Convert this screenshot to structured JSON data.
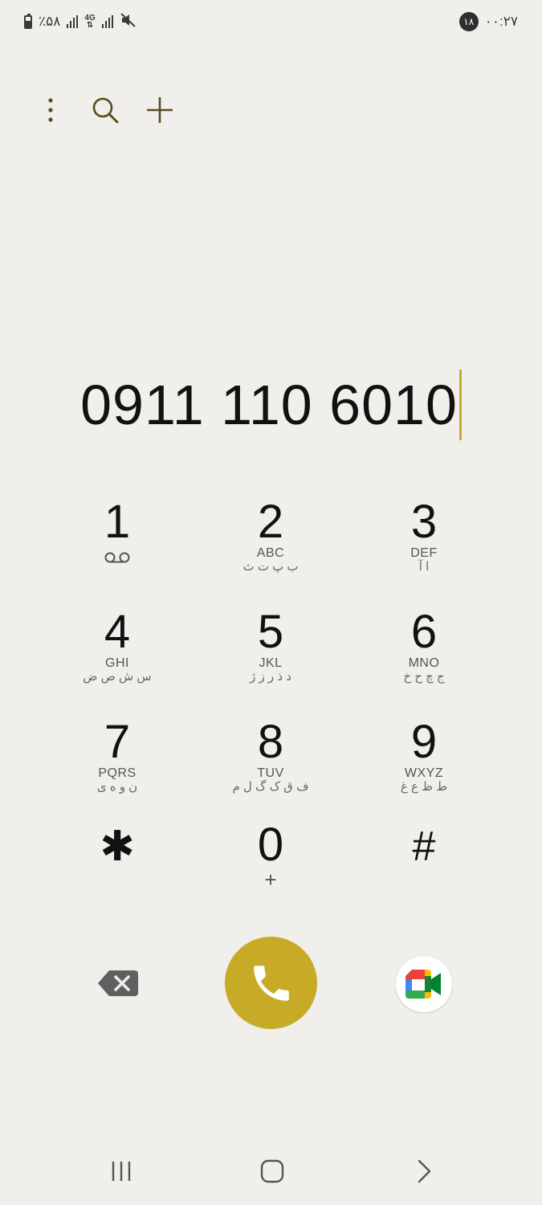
{
  "status_bar": {
    "battery_text": "٪۵۸",
    "network_type": "4G",
    "notification_count": "۱۸",
    "time": "۰۰:۲۷"
  },
  "toolbar": {
    "more_icon": "more-vert-icon",
    "search_icon": "search-icon",
    "add_icon": "add-icon"
  },
  "dialer": {
    "number": "0911 110 6010",
    "accent_color": "#c7ab27",
    "keys": [
      {
        "digit": "1",
        "letters": "",
        "farsi": "",
        "sub": "voicemail-icon"
      },
      {
        "digit": "2",
        "letters": "ABC",
        "farsi": "ب پ ت ث",
        "sub": ""
      },
      {
        "digit": "3",
        "letters": "DEF",
        "farsi": "ا آ",
        "sub": ""
      },
      {
        "digit": "4",
        "letters": "GHI",
        "farsi": "س ش ص ض",
        "sub": ""
      },
      {
        "digit": "5",
        "letters": "JKL",
        "farsi": "د ذ ر ز ژ",
        "sub": ""
      },
      {
        "digit": "6",
        "letters": "MNO",
        "farsi": "ج چ ح خ",
        "sub": ""
      },
      {
        "digit": "7",
        "letters": "PQRS",
        "farsi": "ن و ه ی",
        "sub": ""
      },
      {
        "digit": "8",
        "letters": "TUV",
        "farsi": "ف ق ک گ ل م",
        "sub": ""
      },
      {
        "digit": "9",
        "letters": "WXYZ",
        "farsi": "ط ظ ع غ",
        "sub": ""
      },
      {
        "digit": "✱",
        "letters": "",
        "farsi": "",
        "sub": ""
      },
      {
        "digit": "0",
        "letters": "",
        "farsi": "",
        "sub": "+"
      },
      {
        "digit": "#",
        "letters": "",
        "farsi": "",
        "sub": ""
      }
    ]
  },
  "actions": {
    "backspace_icon": "backspace-icon",
    "call_icon": "phone-icon",
    "video_icon": "google-meet-icon"
  },
  "nav": {
    "recents_icon": "recents-icon",
    "home_icon": "home-icon",
    "back_icon": "back-icon"
  }
}
